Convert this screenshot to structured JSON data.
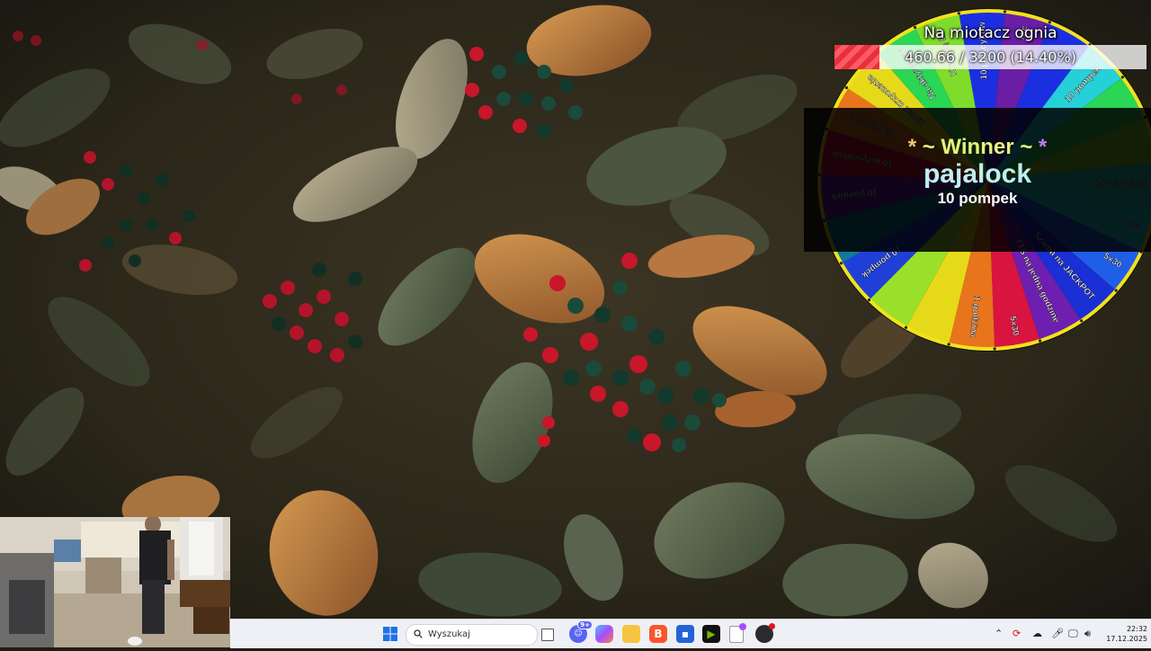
{
  "goal": {
    "title": "Na miotacz ognia",
    "progress_text": "460.66 / 3200 (14.40%)",
    "progress_fraction": 0.144,
    "fill_color": "#e8303d"
  },
  "winner": {
    "star_left": "*",
    "label": "~ Winner ~",
    "star_right": "*",
    "name": "pajalock",
    "prize": "10 pompek"
  },
  "wheel": {
    "segments": [
      {
        "label": "10 pajacyków",
        "color": "#1c2fe0"
      },
      {
        "label": "Nic",
        "color": "#6a1ea6"
      },
      {
        "label": "",
        "color": "#1c2fe0"
      },
      {
        "label": "10 pompek",
        "color": "#25d0d8"
      },
      {
        "label": "",
        "color": "#2ad654"
      },
      {
        "label": "",
        "color": "#7fdc2a"
      },
      {
        "label": "ASG w placy",
        "color": "#28d6c4"
      },
      {
        "label": "Nic",
        "color": "#24d8e6"
      },
      {
        "label": "5x30",
        "color": "#1f5fe8"
      },
      {
        "label": "Szama na JACKPOT",
        "color": "#1a2fd4"
      },
      {
        "label": "TTS na jedną godzinę",
        "color": "#6e1fb0"
      },
      {
        "label": "5x30",
        "color": "#d8143f"
      },
      {
        "label": "1 godzina",
        "color": "#e8741c"
      },
      {
        "label": "",
        "color": "#e6d91a"
      },
      {
        "label": "",
        "color": "#9ae02a"
      },
      {
        "label": "10 pompek",
        "color": "#1f3fd8"
      },
      {
        "label": "",
        "color": "#0f7a9a"
      },
      {
        "label": "10 pompek",
        "color": "#6e1fb0"
      },
      {
        "label": "10 przysiadów",
        "color": "#d8143f"
      },
      {
        "label": "Zakrzywiony",
        "color": "#e8741c"
      },
      {
        "label": "Zakaz krzyczenia",
        "color": "#e6d91a"
      },
      {
        "label": "Na aktywność",
        "color": "#2ad654"
      },
      {
        "label": "Krzyczę Bo",
        "color": "#7fdc2a"
      }
    ],
    "rim_color": "#f2e21a"
  },
  "taskbar": {
    "search_placeholder": "Wyszukaj",
    "time": "22:32",
    "date": "17.12.2025",
    "discord_badge": "9+"
  }
}
